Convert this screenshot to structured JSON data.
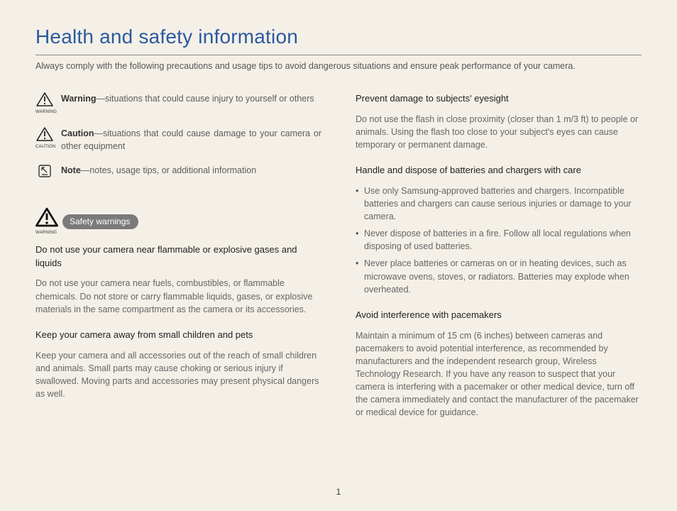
{
  "title": "Health and safety information",
  "intro": "Always comply with the following precautions and usage tips to avoid dangerous situations and ensure peak performance of your camera.",
  "defs": {
    "warning_term": "Warning",
    "warning_desc": "—situations that could cause injury to yourself or others",
    "warning_sub": "WARNING",
    "caution_term": "Caution",
    "caution_desc": "—situations that could cause damage to your camera or other equipment",
    "caution_sub": "CAUTION",
    "note_term": "Note",
    "note_desc": "—notes, usage tips, or additional information"
  },
  "safety_warnings_badge": "Safety warnings",
  "safety_warnings_sub": "WARNING",
  "left": {
    "h1": "Do not use your camera near flammable or explosive gases and liquids",
    "p1": "Do not use your camera near fuels, combustibles, or flammable chemicals. Do not store or carry flammable liquids, gases, or explosive materials in the same compartment as the camera or its accessories.",
    "h2": "Keep your camera away from small children and pets",
    "p2": "Keep your camera and all accessories out of the reach of small children and animals. Small parts may cause choking or serious injury if swallowed. Moving parts and accessories may present physical dangers as well."
  },
  "right": {
    "h1": "Prevent damage to subjects' eyesight",
    "p1": "Do not use the flash in close proximity (closer than 1 m/3 ft) to people or animals. Using the flash too close to your subject's eyes can cause temporary or permanent damage.",
    "h2": "Handle and dispose of batteries and chargers with care",
    "bul": [
      "Use only Samsung-approved batteries and chargers. Incompatible batteries and chargers can cause serious injuries or damage to your camera.",
      "Never dispose of batteries in a fire. Follow all local regulations when disposing of used batteries.",
      "Never place batteries or cameras on or in heating devices, such as microwave ovens, stoves, or radiators. Batteries may explode when overheated."
    ],
    "h3": "Avoid interference with pacemakers",
    "p3": "Maintain a minimum of 15 cm (6 inches) between cameras and pacemakers to avoid potential interference, as recommended by manufacturers and the independent research group, Wireless Technology Research. If you have any reason to suspect that your camera is interfering with a pacemaker or other medical device, turn off the camera immediately and contact the manufacturer of the pacemaker or medical device for guidance."
  },
  "page_number": "1"
}
